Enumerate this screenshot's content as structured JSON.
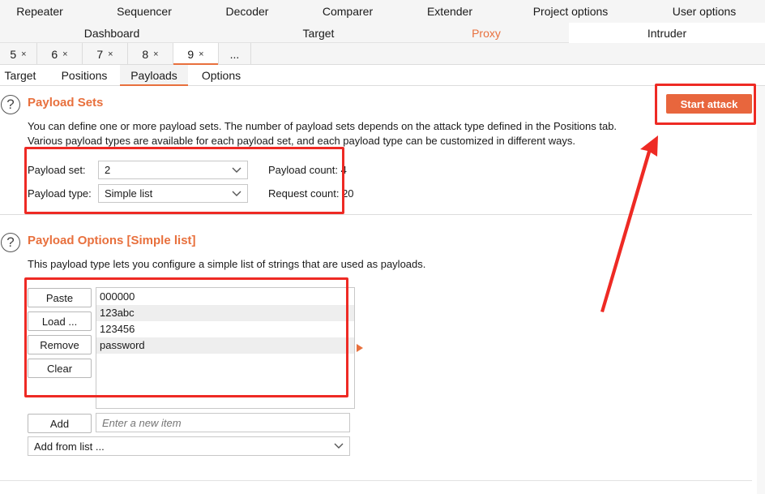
{
  "tool_tabs_row1": [
    "Repeater",
    "Sequencer",
    "Decoder",
    "Comparer",
    "Extender",
    "Project options",
    "User options"
  ],
  "tool_tabs_row2": [
    "Dashboard",
    "Target",
    "Proxy",
    "Intruder"
  ],
  "request_tabs": [
    {
      "label": "5",
      "close": "×"
    },
    {
      "label": "6",
      "close": "×"
    },
    {
      "label": "7",
      "close": "×"
    },
    {
      "label": "8",
      "close": "×"
    },
    {
      "label": "9",
      "close": "×"
    },
    {
      "label": "...",
      "close": ""
    }
  ],
  "sub_tabs": [
    "Target",
    "Positions",
    "Payloads",
    "Options"
  ],
  "active_sub_tab": "Payloads",
  "payload_sets": {
    "title": "Payload Sets",
    "description_line1": "You can define one or more payload sets. The number of payload sets depends on the attack type defined in the Positions tab.",
    "description_line2": "Various payload types are available for each payload set, and each payload type can be customized in different ways.",
    "payload_set_label": "Payload set:",
    "payload_set_value": "2",
    "payload_type_label": "Payload type:",
    "payload_type_value": "Simple list",
    "payload_count_label": "Payload count:",
    "payload_count_value": "4",
    "request_count_label": "Request count:",
    "request_count_value": "20",
    "start_attack_label": "Start attack"
  },
  "payload_options": {
    "title": "Payload Options [Simple list]",
    "description": "This payload type lets you configure a simple list of strings that are used as payloads.",
    "buttons": {
      "paste": "Paste",
      "load": "Load ...",
      "remove": "Remove",
      "clear": "Clear",
      "add": "Add"
    },
    "items": [
      "000000",
      "123abc",
      "123456",
      "password"
    ],
    "new_item_placeholder": "Enter a new item",
    "add_from_list": "Add from list ..."
  },
  "colors": {
    "accent": "#e8703d",
    "annotation": "#ee2a24"
  },
  "icons": {
    "help": "help-circle-icon",
    "chevron": "chevron-down-icon",
    "close": "close-icon"
  }
}
